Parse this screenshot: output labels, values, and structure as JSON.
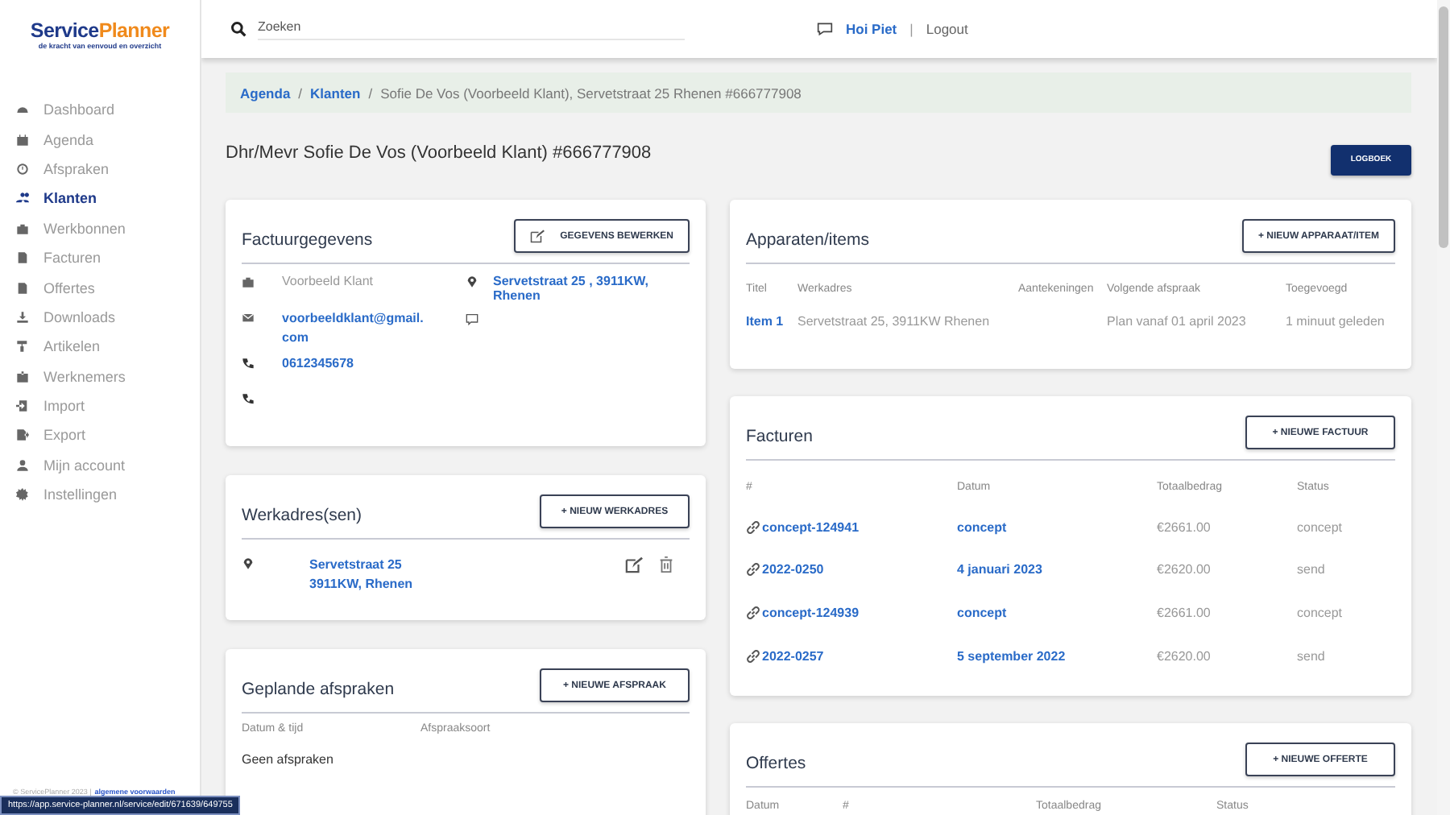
{
  "logo": {
    "part1": "Service",
    "part2": "Planner",
    "tagline": "de kracht van eenvoud en overzicht"
  },
  "sidebar": {
    "items": [
      {
        "label": "Dashboard",
        "selected": false
      },
      {
        "label": "Agenda",
        "selected": false
      },
      {
        "label": "Afspraken",
        "selected": false
      },
      {
        "label": "Klanten",
        "selected": true
      },
      {
        "label": "Werkbonnen",
        "selected": false
      },
      {
        "label": "Facturen",
        "selected": false
      },
      {
        "label": "Offertes",
        "selected": false
      },
      {
        "label": "Downloads",
        "selected": false
      },
      {
        "label": "Artikelen",
        "selected": false
      },
      {
        "label": "Werknemers",
        "selected": false
      },
      {
        "label": "Import",
        "selected": false
      },
      {
        "label": "Export",
        "selected": false
      },
      {
        "label": "Mijn account",
        "selected": false
      },
      {
        "label": "Instellingen",
        "selected": false
      }
    ],
    "footer": {
      "copyright": "© ServicePlanner 2023 |",
      "link": "algemene voorwaarden"
    }
  },
  "topbar": {
    "search": {
      "placeholder": "Zoeken"
    },
    "greeting": "Hoi Piet",
    "separator": "|",
    "logout": "Logout"
  },
  "breadcrumb": {
    "links": [
      {
        "label": "Agenda",
        "separator": "/"
      },
      {
        "label": "Klanten",
        "separator": "/"
      }
    ],
    "current": "Sofie De Vos (Voorbeeld Klant), Servetstraat 25 Rhenen #666777908"
  },
  "page_title": "Dhr/Mevr Sofie De Vos (Voorbeeld Klant) #666777908",
  "logbook_button": "LOGBOEK",
  "billing": {
    "title": "Factuurgegevens",
    "button": "GEGEVENS BEWERKEN",
    "company": "Voorbeeld Klant",
    "email": "voorbeeldklant@gmail.com",
    "phone": "0612345678",
    "address": "Servetstraat 25 , 3911KW, Rhenen"
  },
  "work_addresses": {
    "title": "Werkadres(sen)",
    "button": "+ NIEUW WERKADRES",
    "items": [
      {
        "lines": [
          "Servetstraat 25",
          "3911KW, Rhenen"
        ]
      }
    ]
  },
  "appointments": {
    "title": "Geplande afspraken",
    "button": "+ NIEUWE AFSPRAAK",
    "columns": [
      "Datum & tijd",
      "Afspraaksoort"
    ],
    "empty": "Geen afspraken"
  },
  "devices": {
    "title": "Apparaten/items",
    "button": "+ NIEUW APPARAAT/ITEM",
    "columns": [
      "Titel",
      "Werkadres",
      "Aantekeningen",
      "Volgende afspraak",
      "Toegevoegd"
    ],
    "rows": [
      {
        "title": "Item 1",
        "address": "Servetstraat 25, 3911KW Rhenen",
        "next": "Plan vanaf 01 april 2023",
        "added": "1 minuut geleden"
      }
    ]
  },
  "invoices": {
    "title": "Facturen",
    "button": "+ NIEUWE FACTUUR",
    "columns": [
      "#",
      "Datum",
      "Totaalbedrag",
      "Status"
    ],
    "rows": [
      {
        "number": "concept-124941",
        "date": "concept",
        "amount": "€2661.00",
        "status": "concept"
      },
      {
        "number": "2022-0250",
        "date": "4 januari 2023",
        "amount": "€2620.00",
        "status": "send"
      },
      {
        "number": "concept-124939",
        "date": "concept",
        "amount": "€2661.00",
        "status": "concept"
      },
      {
        "number": "2022-0257",
        "date": "5 september 2022",
        "amount": "€2620.00",
        "status": "send"
      }
    ]
  },
  "quotes": {
    "title": "Offertes",
    "button": "+ NIEUWE OFFERTE",
    "columns": [
      "Datum",
      "#",
      "Totaalbedrag",
      "Status"
    ]
  },
  "status_bar": {
    "url": "https://app.service-planner.nl/service/edit/671639/649755"
  }
}
